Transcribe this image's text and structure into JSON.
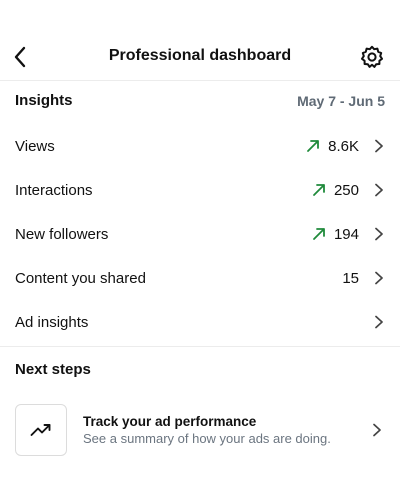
{
  "header": {
    "title": "Professional dashboard",
    "back_icon": "chevron-left-icon",
    "settings_icon": "gear-icon"
  },
  "insights": {
    "title": "Insights",
    "date_range": "May 7 - Jun 5",
    "rows": [
      {
        "label": "Views",
        "value": "8.6K",
        "trend": "up"
      },
      {
        "label": "Interactions",
        "value": "250",
        "trend": "up"
      },
      {
        "label": "New followers",
        "value": "194",
        "trend": "up"
      },
      {
        "label": "Content you shared",
        "value": "15",
        "trend": ""
      },
      {
        "label": "Ad insights",
        "value": "",
        "trend": ""
      }
    ]
  },
  "next_steps": {
    "title": "Next steps",
    "card": {
      "title": "Track your ad performance",
      "subtitle": "See a summary of how your ads are doing.",
      "icon": "trending-up-icon"
    }
  },
  "colors": {
    "trend_up": "#1f8a3b",
    "muted_text": "#5f6a75",
    "divider": "#ececec"
  }
}
